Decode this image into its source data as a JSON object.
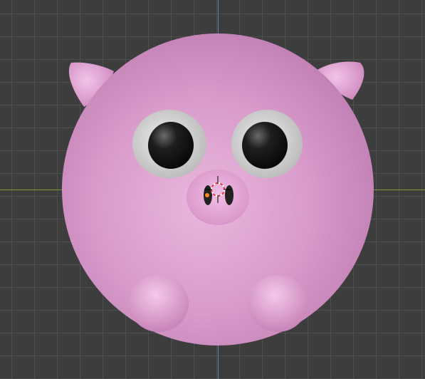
{
  "viewport": {
    "background": "#3d3d3d",
    "grid_color": "#4f4f4f",
    "axis_x_color": "#7d9a3a",
    "axis_y_color": "#5a7fb8"
  },
  "model": {
    "name_icon": "pig-icon",
    "body_color": "#d89ac8",
    "ear_color": "#e6a6d6",
    "eye_white": "#dcdcdc",
    "eye_pupil": "#1a1a1a",
    "snout_color": "#e7a9d9",
    "nostril_color": "#222222",
    "feet_color": "#e3a2d2"
  },
  "gizmo": {
    "name_icon": "3d-cursor-icon",
    "origin_color": "#ff8c1a"
  }
}
